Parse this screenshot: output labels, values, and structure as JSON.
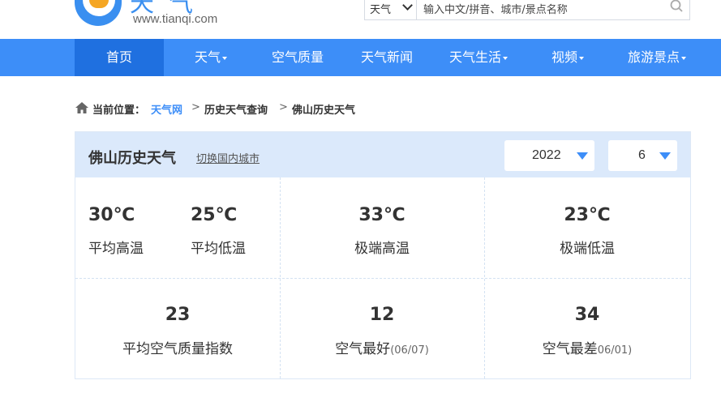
{
  "header": {
    "logo_chars": "天气",
    "logo_domain": "www.tianqi.com",
    "search": {
      "select_value": "天气",
      "placeholder": "输入中文/拼音、城市/景点名称"
    }
  },
  "nav": {
    "items": [
      {
        "label": "首页",
        "has_dropdown": false,
        "active": true
      },
      {
        "label": "天气",
        "has_dropdown": true,
        "active": false
      },
      {
        "label": "空气质量",
        "has_dropdown": false,
        "active": false
      },
      {
        "label": "天气新闻",
        "has_dropdown": false,
        "active": false
      },
      {
        "label": "天气生活",
        "has_dropdown": true,
        "active": false
      },
      {
        "label": "视频",
        "has_dropdown": true,
        "active": false
      },
      {
        "label": "旅游景点",
        "has_dropdown": true,
        "active": false
      }
    ]
  },
  "breadcrumb": {
    "prefix": "当前位置：",
    "items": [
      "天气网",
      "历史天气查询",
      "佛山历史天气"
    ],
    "separator": ">"
  },
  "panel": {
    "title": "佛山历史天气",
    "switch_city": "切换国内城市",
    "year": "2022",
    "month": "6"
  },
  "stats": {
    "avg_high": {
      "value": "30℃",
      "label": "平均高温"
    },
    "avg_low": {
      "value": "25℃",
      "label": "平均低温"
    },
    "extreme_high": {
      "value": "33℃",
      "label": "极端高温"
    },
    "extreme_low": {
      "value": "23℃",
      "label": "极端低温"
    },
    "avg_aqi": {
      "value": "23",
      "label": "平均空气质量指数"
    },
    "best_air": {
      "value": "12",
      "label": "空气最好",
      "date": "(06/07)"
    },
    "worst_air": {
      "value": "34",
      "label": "空气最差",
      "date": "06/01)"
    }
  },
  "colors": {
    "nav_bg": "#3d8ef8",
    "nav_active": "#1f70e0",
    "panel_head_bg": "#dbe9fb",
    "link": "#3d8ef8"
  }
}
